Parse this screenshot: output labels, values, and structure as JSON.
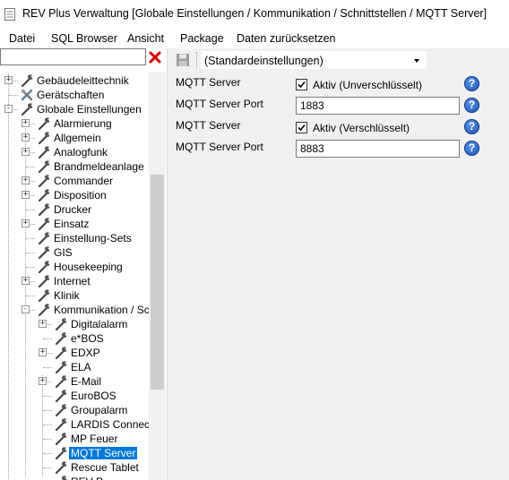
{
  "window": {
    "title": "REV Plus Verwaltung [Globale Einstellungen / Kommunikation / Schnittstellen / MQTT Server]"
  },
  "menu": [
    "Datei",
    "SQL Browser",
    "Ansicht",
    "Package",
    "Daten zurücksetzen"
  ],
  "search": {
    "value": "",
    "clear_icon": "red-x-icon"
  },
  "tree": [
    {
      "label": "Gebäudeleittechnik",
      "depth": 0,
      "expander": "+",
      "icon": "wrench-icon"
    },
    {
      "label": "Gerätschaften",
      "depth": 0,
      "expander": "",
      "icon": "tools-icon"
    },
    {
      "label": "Globale Einstellungen",
      "depth": 0,
      "expander": "-",
      "icon": "wrench-icon"
    },
    {
      "label": "Alarmierung",
      "depth": 1,
      "expander": "+",
      "icon": "wrench-icon"
    },
    {
      "label": "Allgemein",
      "depth": 1,
      "expander": "+",
      "icon": "wrench-icon"
    },
    {
      "label": "Analogfunk",
      "depth": 1,
      "expander": "+",
      "icon": "wrench-icon"
    },
    {
      "label": "Brandmeldeanlage",
      "depth": 1,
      "expander": "",
      "icon": "wrench-icon"
    },
    {
      "label": "Commander",
      "depth": 1,
      "expander": "+",
      "icon": "wrench-icon"
    },
    {
      "label": "Disposition",
      "depth": 1,
      "expander": "+",
      "icon": "wrench-icon"
    },
    {
      "label": "Drucker",
      "depth": 1,
      "expander": "",
      "icon": "wrench-icon"
    },
    {
      "label": "Einsatz",
      "depth": 1,
      "expander": "+",
      "icon": "wrench-icon"
    },
    {
      "label": "Einstellung-Sets",
      "depth": 1,
      "expander": "",
      "icon": "wrench-icon"
    },
    {
      "label": "GIS",
      "depth": 1,
      "expander": "",
      "icon": "wrench-icon"
    },
    {
      "label": "Housekeeping",
      "depth": 1,
      "expander": "",
      "icon": "wrench-icon"
    },
    {
      "label": "Internet",
      "depth": 1,
      "expander": "+",
      "icon": "wrench-icon"
    },
    {
      "label": "Klinik",
      "depth": 1,
      "expander": "",
      "icon": "wrench-icon"
    },
    {
      "label": "Kommunikation / Schnittstellen",
      "depth": 1,
      "expander": "-",
      "icon": "wrench-icon"
    },
    {
      "label": "Digitalalarm",
      "depth": 2,
      "expander": "+",
      "icon": "wrench-icon"
    },
    {
      "label": "e*BOS",
      "depth": 2,
      "expander": "",
      "icon": "wrench-icon"
    },
    {
      "label": "EDXP",
      "depth": 2,
      "expander": "+",
      "icon": "wrench-icon"
    },
    {
      "label": "ELA",
      "depth": 2,
      "expander": "",
      "icon": "wrench-icon"
    },
    {
      "label": "E-Mail",
      "depth": 2,
      "expander": "+",
      "icon": "wrench-icon"
    },
    {
      "label": "EuroBOS",
      "depth": 2,
      "expander": "",
      "icon": "wrench-icon"
    },
    {
      "label": "Groupalarm",
      "depth": 2,
      "expander": "",
      "icon": "wrench-icon"
    },
    {
      "label": "LARDIS Connect",
      "depth": 2,
      "expander": "",
      "icon": "wrench-icon"
    },
    {
      "label": "MP Feuer",
      "depth": 2,
      "expander": "",
      "icon": "wrench-icon"
    },
    {
      "label": "MQTT Server",
      "depth": 2,
      "expander": "",
      "icon": "wrench-icon",
      "selected": true
    },
    {
      "label": "Rescue Tablet",
      "depth": 2,
      "expander": "",
      "icon": "wrench-icon"
    },
    {
      "label": "REV P",
      "depth": 2,
      "expander": "",
      "icon": "wrench-icon"
    }
  ],
  "toolbar": {
    "save_icon": "floppy-disk-icon",
    "profile": "(Standardeinstellungen)"
  },
  "settings": [
    {
      "label": "MQTT Server",
      "type": "checkbox",
      "checked": true,
      "text": "Aktiv (Unverschlüsselt)"
    },
    {
      "label": "MQTT Server Port",
      "type": "text",
      "value": "1883"
    },
    {
      "label": "MQTT Server",
      "type": "checkbox",
      "checked": true,
      "text": "Aktiv (Verschlüsselt)"
    },
    {
      "label": "MQTT Server Port",
      "type": "text",
      "value": "8883"
    }
  ],
  "help_icon": "help-question-icon",
  "colors": {
    "selection": "#0078d7",
    "help_blue": "#1d53b8",
    "clear_red": "#d40000"
  }
}
